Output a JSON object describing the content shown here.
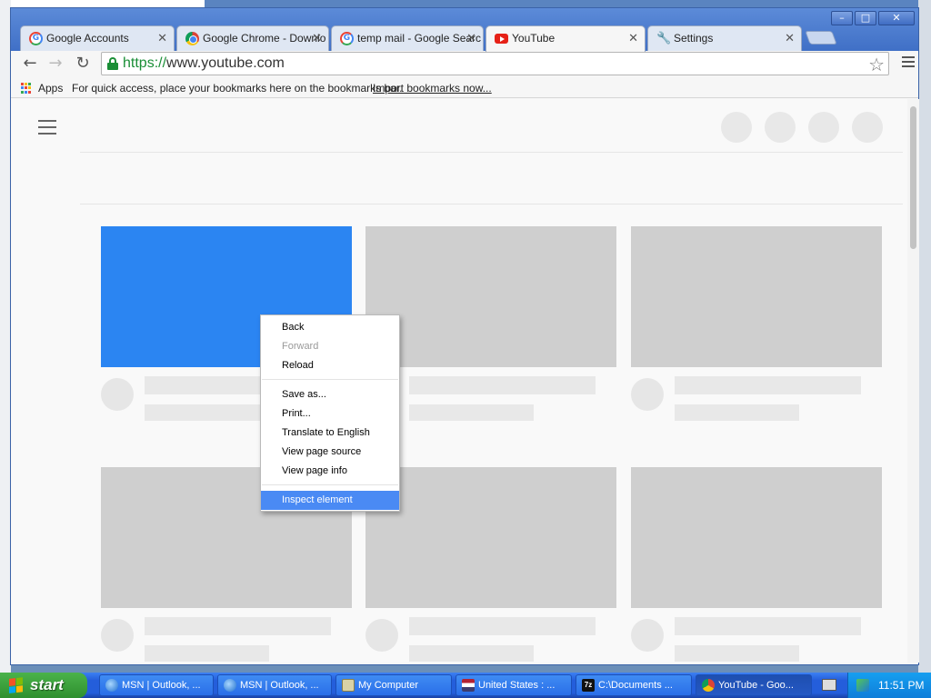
{
  "window": {
    "controls": {
      "minimize": "–",
      "maximize": "□",
      "close": "✕"
    }
  },
  "tabs": [
    {
      "title": "Google Accounts",
      "icon": "google-g-icon",
      "active": false
    },
    {
      "title": "Google Chrome - Downlo",
      "icon": "chrome-icon",
      "active": false
    },
    {
      "title": "temp mail - Google Searc",
      "icon": "google-g-icon",
      "active": false
    },
    {
      "title": "YouTube",
      "icon": "youtube-icon",
      "active": true
    },
    {
      "title": "Settings",
      "icon": "wrench-icon",
      "active": false
    }
  ],
  "toolbar": {
    "back_glyph": "←",
    "forward_glyph": "→",
    "reload_glyph": "↻",
    "url_scheme": "https://",
    "url_rest": "www.youtube.com",
    "star_glyph": "☆"
  },
  "bookmarks": {
    "apps_label": "Apps",
    "hint": "For quick access, place your bookmarks here on the bookmarks bar.",
    "import_link": "Import bookmarks now..."
  },
  "page": {
    "accent_color": "#2b85f2",
    "placeholder_color": "#cfcfcf"
  },
  "context_menu": {
    "groups": [
      [
        {
          "label": "Back",
          "enabled": true
        },
        {
          "label": "Forward",
          "enabled": false
        },
        {
          "label": "Reload",
          "enabled": true
        }
      ],
      [
        {
          "label": "Save as...",
          "enabled": true
        },
        {
          "label": "Print...",
          "enabled": true
        },
        {
          "label": "Translate to English",
          "enabled": true
        },
        {
          "label": "View page source",
          "enabled": true
        },
        {
          "label": "View page info",
          "enabled": true
        }
      ],
      [
        {
          "label": "Inspect element",
          "enabled": true,
          "highlighted": true
        }
      ]
    ]
  },
  "taskbar": {
    "start_label": "start",
    "items": [
      {
        "label": "MSN | Outlook, ...",
        "icon": "ie-icon",
        "active": false
      },
      {
        "label": "MSN | Outlook, ...",
        "icon": "ie-icon",
        "active": false
      },
      {
        "label": "My Computer",
        "icon": "my-computer-icon",
        "active": false
      },
      {
        "label": "United States : ...",
        "icon": "flag-icon",
        "active": false
      },
      {
        "label": "C:\\Documents ...",
        "icon": "7zip-icon",
        "active": false
      },
      {
        "label": "YouTube - Goo...",
        "icon": "chrome-icon",
        "active": true
      }
    ],
    "clock": "11:51 PM"
  }
}
